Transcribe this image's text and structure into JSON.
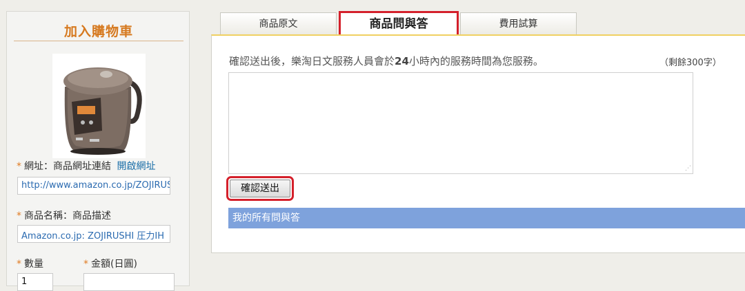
{
  "sidebar": {
    "title": "加入購物車",
    "url_label": "網址：商品網址連結",
    "url_link": "開啟網址",
    "url_value": "http://www.amazon.co.jp/ZOJIRUSHI",
    "name_label": "商品名稱：商品描述",
    "name_value": "Amazon.co.jp: ZOJIRUSHI 圧力IH",
    "qty_label": "數量",
    "qty_value": "1",
    "amount_label": "金額(日圓)",
    "amount_value": "",
    "required_mark": "*"
  },
  "tabs": [
    {
      "label": "商品原文"
    },
    {
      "label": "商品問與答"
    },
    {
      "label": "費用試算"
    }
  ],
  "qa": {
    "notice_pre": "確認送出後，樂淘日文服務人員會於",
    "notice_hours": "24",
    "notice_post": "小時內的服務時間為您服務。",
    "remaining": "（剩餘300字）",
    "textarea_value": "",
    "submit_label": "確認送出",
    "my_qa_label": "我的所有問與答"
  },
  "colors": {
    "accent_orange": "#d6791f",
    "highlight_red": "#d4202b",
    "qa_bar_blue": "#7ea2dc"
  },
  "icons": {
    "resize_grip": "resize-grip-icon"
  }
}
